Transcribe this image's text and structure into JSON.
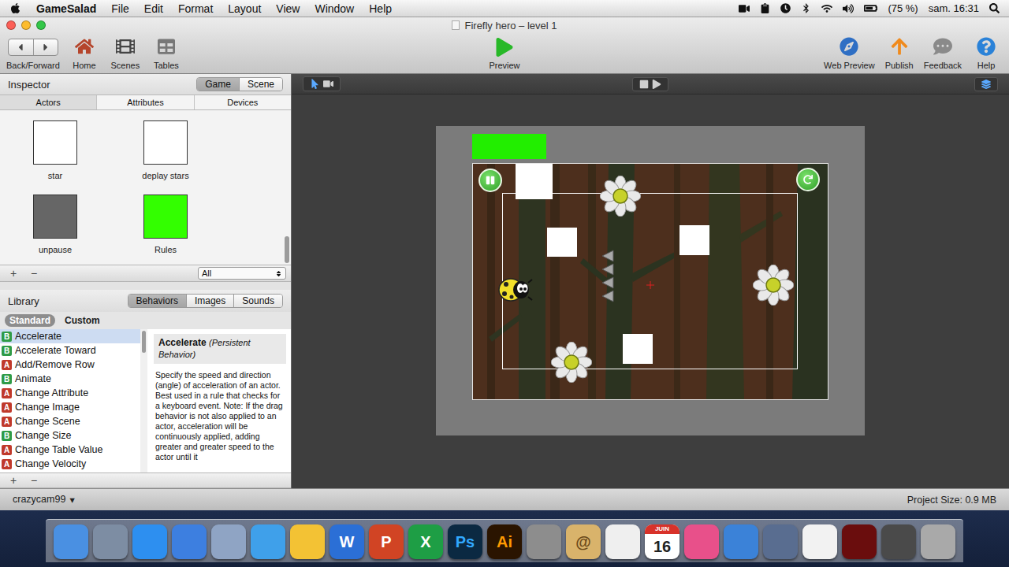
{
  "menu_bar": {
    "app": "GameSalad",
    "items": [
      "File",
      "Edit",
      "Format",
      "Layout",
      "View",
      "Window",
      "Help"
    ],
    "battery": "(75 %)",
    "clock": "sam. 16:31"
  },
  "window": {
    "title": "Firefly hero – level 1"
  },
  "toolbar": {
    "left": [
      "Back/Forward",
      "Home",
      "Scenes",
      "Tables"
    ],
    "center": "Preview",
    "right": [
      "Web Preview",
      "Publish",
      "Feedback",
      "Help"
    ]
  },
  "inspector": {
    "title": "Inspector",
    "modes": [
      {
        "label": "Game",
        "selected": true
      },
      {
        "label": "Scene",
        "selected": false
      }
    ],
    "tabs": [
      {
        "label": "Actors",
        "selected": true
      },
      {
        "label": "Attributes",
        "selected": false
      },
      {
        "label": "Devices",
        "selected": false
      }
    ],
    "actors": [
      {
        "name": "star",
        "color": "#ffffff"
      },
      {
        "name": "deplay stars",
        "color": "#ffffff"
      },
      {
        "name": "unpause",
        "color": "#666666"
      },
      {
        "name": "Rules",
        "color": "#33ff00"
      }
    ],
    "add": "+",
    "remove": "−",
    "filter": "All"
  },
  "library": {
    "title": "Library",
    "tabs": [
      {
        "label": "Behaviors",
        "selected": true
      },
      {
        "label": "Images",
        "selected": false
      },
      {
        "label": "Sounds",
        "selected": false
      }
    ],
    "groups": [
      {
        "label": "Standard",
        "selected": true
      },
      {
        "label": "Custom",
        "selected": false
      }
    ],
    "behaviors": [
      {
        "name": "Accelerate",
        "badge": "B",
        "kind": "behavior",
        "selected": true
      },
      {
        "name": "Accelerate Toward",
        "badge": "B",
        "kind": "behavior",
        "selected": false
      },
      {
        "name": "Add/Remove Row",
        "badge": "A",
        "kind": "action",
        "selected": false
      },
      {
        "name": "Animate",
        "badge": "B",
        "kind": "behavior",
        "selected": false
      },
      {
        "name": "Change Attribute",
        "badge": "A",
        "kind": "action",
        "selected": false
      },
      {
        "name": "Change Image",
        "badge": "A",
        "kind": "action",
        "selected": false
      },
      {
        "name": "Change Scene",
        "badge": "A",
        "kind": "action",
        "selected": false
      },
      {
        "name": "Change Size",
        "badge": "B",
        "kind": "behavior",
        "selected": false
      },
      {
        "name": "Change Table Value",
        "badge": "A",
        "kind": "action",
        "selected": false
      },
      {
        "name": "Change Velocity",
        "badge": "A",
        "kind": "action",
        "selected": false
      }
    ],
    "description": {
      "title": "Accelerate",
      "subtitle": "(Persistent Behavior)",
      "text": "Specify the speed and direction (angle) of acceleration of an actor. Best used in a rule that checks for a keyboard event. Note: If the drag behavior is not also applied to an actor, acceleration will be continuously applied, adding greater and greater speed to the actor until it"
    },
    "add": "+",
    "remove": "−"
  },
  "scene_toolbar": {
    "tools": [
      {
        "selected": true
      },
      {
        "selected": false
      }
    ]
  },
  "footer": {
    "user": "crazycam99",
    "user_caret": "▾",
    "project_size": "Project Size: 0.9 MB"
  },
  "dock": [
    {
      "label": "",
      "color": "#4a90e2",
      "ink": "#ffffff"
    },
    {
      "label": "",
      "color": "#7d8da3",
      "ink": "#ffffff"
    },
    {
      "label": "",
      "color": "#2d8ff0",
      "ink": "#ffffff"
    },
    {
      "label": "",
      "color": "#3d7fe0",
      "ink": "#ffffff"
    },
    {
      "label": "",
      "color": "#8fa4c4",
      "ink": "#ffffff"
    },
    {
      "label": "",
      "color": "#3fa0ea",
      "ink": "#ffffff"
    },
    {
      "label": "",
      "color": "#f3c234",
      "ink": "#ffffff"
    },
    {
      "label": "W",
      "color": "#2b6fd6",
      "ink": "#ffffff"
    },
    {
      "label": "P",
      "color": "#d14424",
      "ink": "#ffffff"
    },
    {
      "label": "X",
      "color": "#1e9e45",
      "ink": "#ffffff"
    },
    {
      "label": "Ps",
      "color": "#0b2942",
      "ink": "#31a8ff"
    },
    {
      "label": "Ai",
      "color": "#2a1400",
      "ink": "#ff9a00"
    },
    {
      "label": "",
      "color": "#8d8d8d",
      "ink": "#ffffff"
    },
    {
      "label": "@",
      "color": "#d9b36b",
      "ink": "#6b4a1a"
    },
    {
      "label": "",
      "color": "#efefef",
      "ink": "#222222"
    },
    {
      "label": "16",
      "sublabel": "JUIN",
      "color": "#ffffff",
      "ink": "#222222"
    },
    {
      "label": "",
      "color": "#e8508a",
      "ink": "#ffffff"
    },
    {
      "label": "",
      "color": "#3b82d8",
      "ink": "#ffffff"
    },
    {
      "label": "",
      "color": "#596d90",
      "ink": "#ffffff"
    },
    {
      "label": "",
      "color": "#f2f2f2",
      "ink": "#222222"
    },
    {
      "label": "",
      "color": "#6a0d0d",
      "ink": "#ffffff"
    },
    {
      "label": "",
      "color": "#4a4a4a",
      "ink": "#ffffff"
    },
    {
      "label": "",
      "color": "#a9a9a9",
      "ink": "#ffffff"
    }
  ]
}
